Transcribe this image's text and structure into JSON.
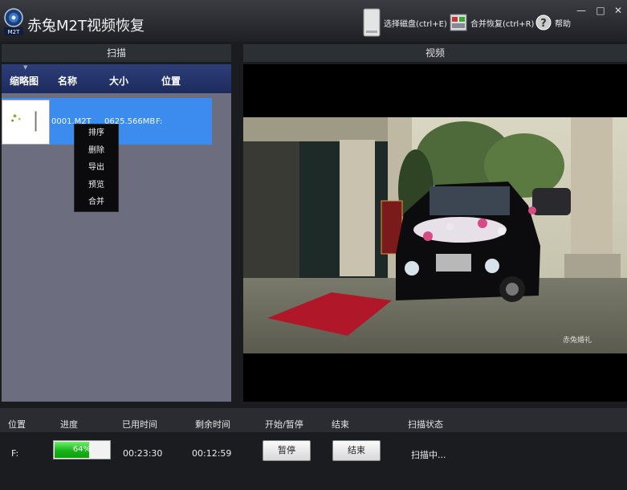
{
  "app": {
    "title": "赤兔M2T视频恢复",
    "logo_text": "M2T"
  },
  "toolbar": {
    "select_disk": "选择磁盘(ctrl+E)",
    "merge_recover": "合并恢复(ctrl+R)",
    "help": "帮助"
  },
  "window_controls": {
    "minimize": "—",
    "maximize": "□",
    "close": "✕"
  },
  "panels": {
    "scan": "扫描",
    "video": "视频"
  },
  "file_table": {
    "columns": [
      "缩略图",
      "名称",
      "大小",
      "位置"
    ],
    "rows": [
      {
        "name": "0001.M2T",
        "size": "0625.566MB",
        "location": "F:"
      }
    ]
  },
  "context_menu": {
    "items": [
      "排序",
      "删除",
      "导出",
      "预览",
      "合并"
    ]
  },
  "video": {
    "watermark": "赤兔婚礼"
  },
  "status": {
    "columns": [
      "位置",
      "进度",
      "已用时间",
      "剩余时间",
      "开始/暂停",
      "结束",
      "扫描状态"
    ],
    "location": "F:",
    "progress": 0.64,
    "progress_text": "64%",
    "elapsed": "00:23:30",
    "remaining": "00:12:59",
    "pause_button": "暂停",
    "end_button": "结束",
    "scan_state": "扫描中..."
  },
  "colors": {
    "accent_blue": "#3c8cf0",
    "header_blue": "#1c2a5e",
    "progress_green": "#18b418",
    "list_bg": "#6c6d7e"
  }
}
